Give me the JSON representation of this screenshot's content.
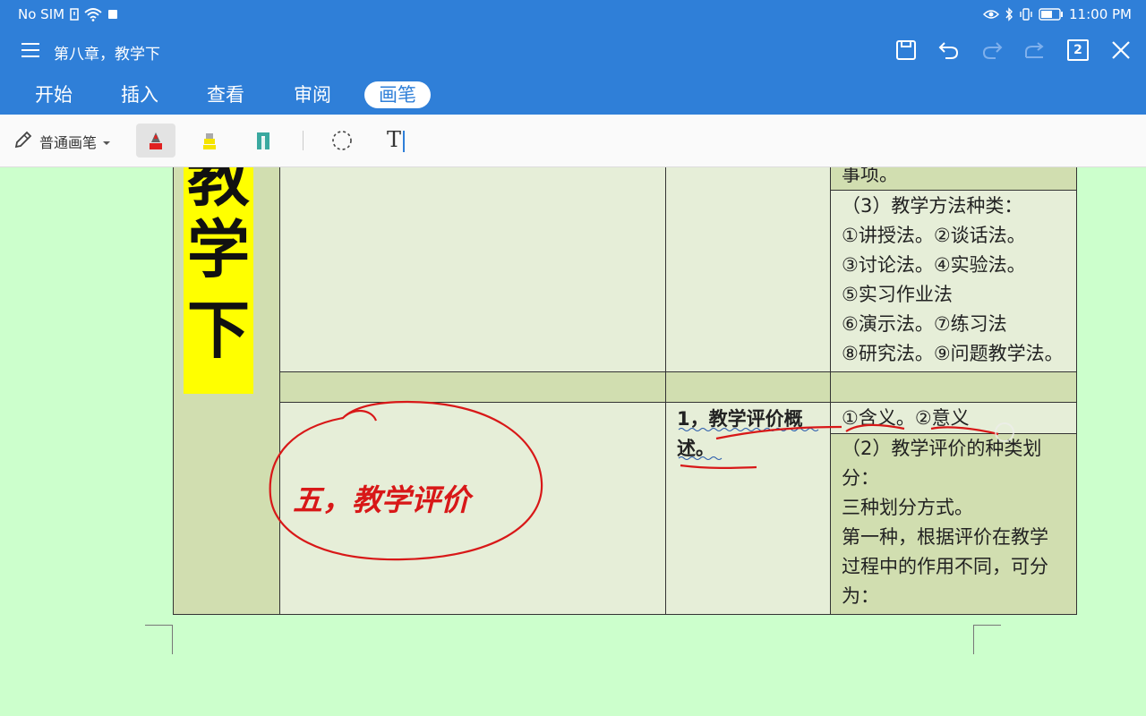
{
  "status_bar": {
    "carrier": "No SIM",
    "time": "11:00 PM"
  },
  "title_bar": {
    "title": "第八章，教学下",
    "page_badge": "2",
    "icons": [
      "menu-icon",
      "save-icon",
      "undo-icon",
      "redo-icon",
      "share-icon",
      "page-count-icon",
      "close-icon"
    ]
  },
  "tabs": [
    "开始",
    "插入",
    "查看",
    "审阅",
    "画笔"
  ],
  "active_tab": "画笔",
  "pen_toolbar": {
    "pen_type": "普通画笔",
    "tools": [
      "red-pen",
      "highlighter-yellow",
      "eraser",
      "lasso",
      "text-box"
    ],
    "selected_tool": "red-pen",
    "colors": {
      "pen": "#e02020",
      "highlighter": "#f5e400",
      "eraser": "#3aa9a0"
    }
  },
  "document": {
    "side_label": [
      "教",
      "学",
      "下"
    ],
    "col4_top_fragment": "事项。",
    "col4_methods": [
      "（3）教学方法种类：",
      "①讲授法。②谈话法。",
      "③讨论法。④实验法。",
      "⑤实习作业法",
      "⑥演示法。⑦练习法",
      "⑧研究法。⑨问题教学法。"
    ],
    "section_title": "五，教学评价",
    "subsection_lines": [
      "1，教学评价概",
      "述。"
    ],
    "col4_eval_meaning": "①含义。②意义",
    "col4_eval_types": [
      "（2）教学评价的种类划",
      "分：",
      "三种划分方式。",
      "第一种，根据评价在教学",
      "过程中的作用不同，可分",
      "为："
    ]
  },
  "colors": {
    "app_blue": "#2f7fd8",
    "page_bg": "#ccffcc",
    "table_light": "#e6eed8",
    "table_dark": "#d1deb0",
    "label_yellow": "#ffff00",
    "ink_red": "#d81818"
  }
}
